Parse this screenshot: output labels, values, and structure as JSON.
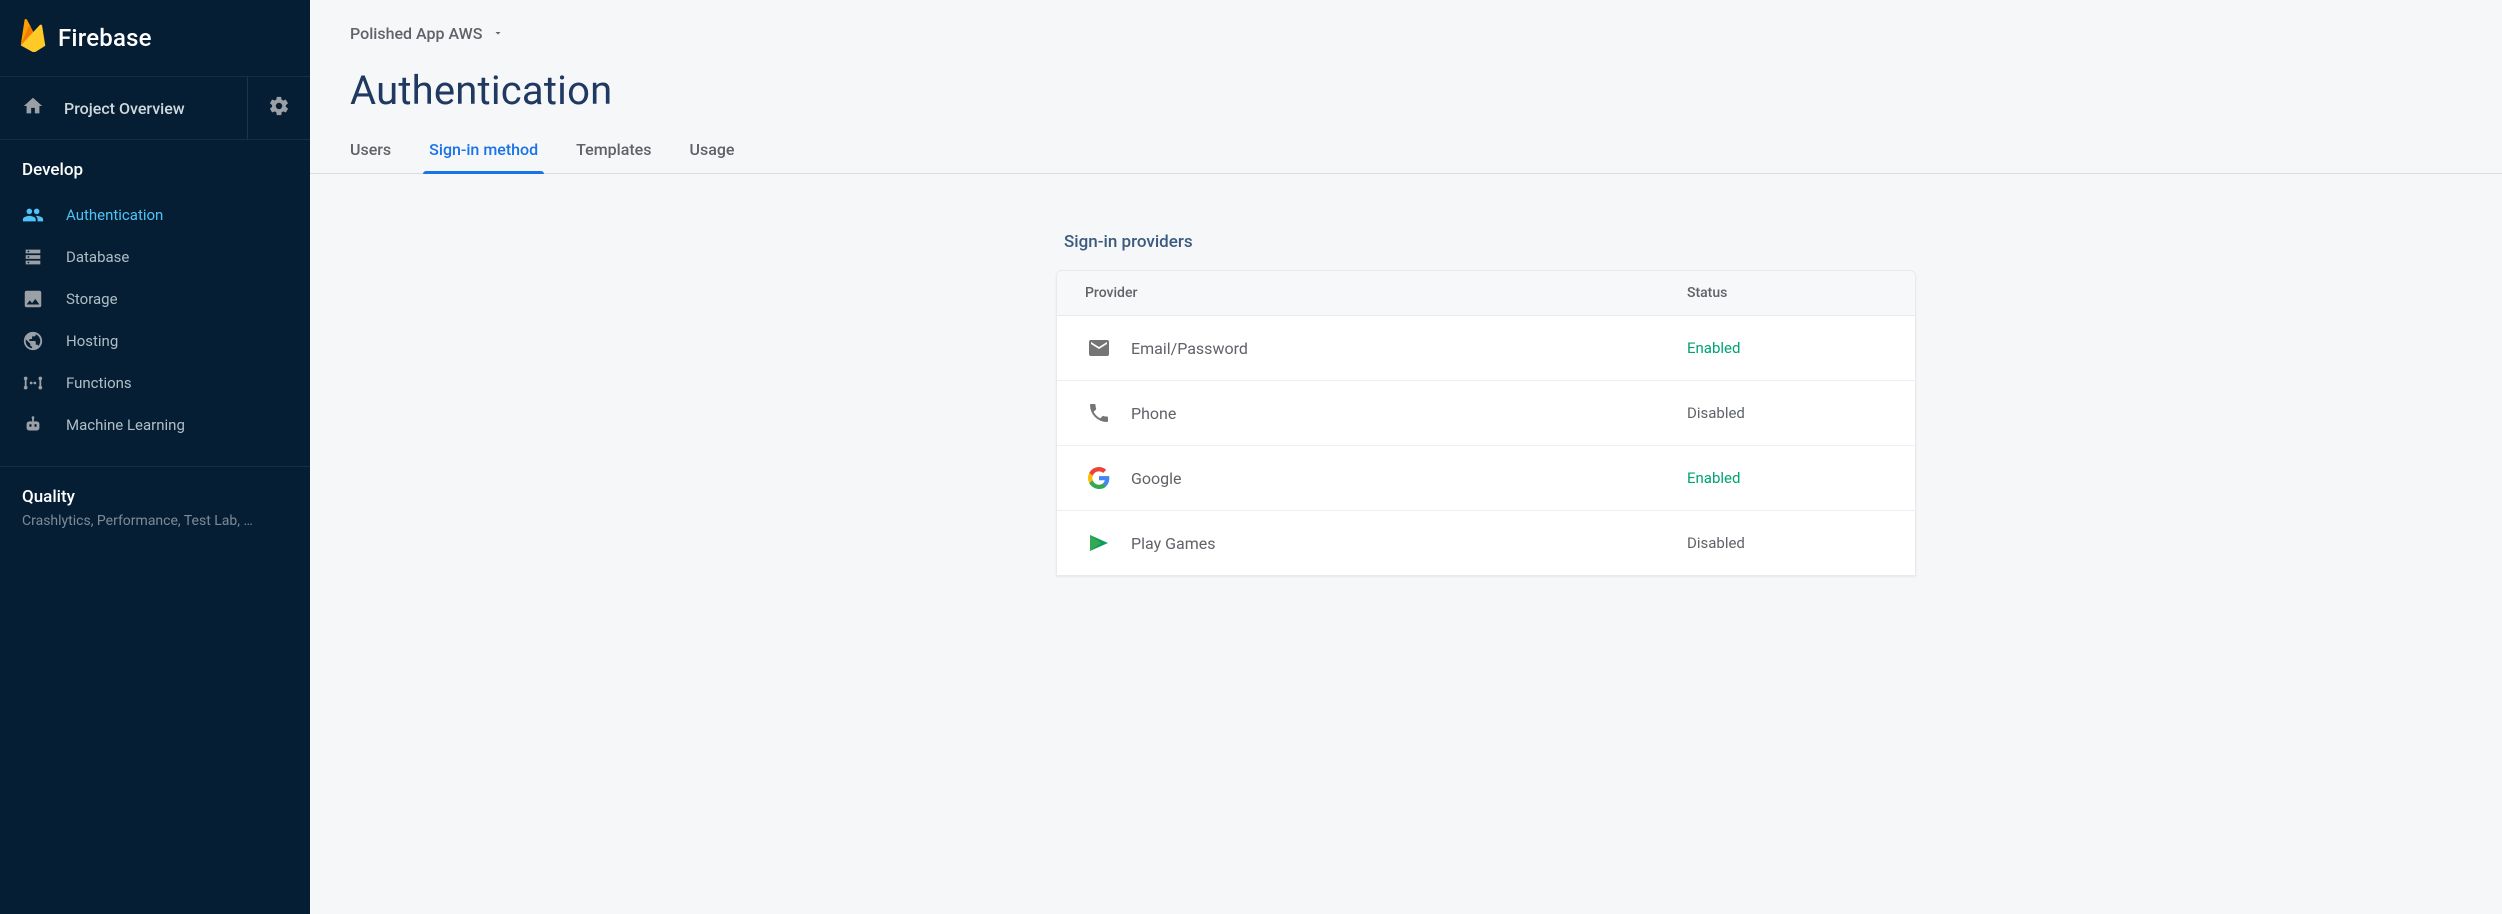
{
  "brand": "Firebase",
  "sidebar": {
    "overview": "Project Overview",
    "sections": {
      "develop": {
        "title": "Develop",
        "items": [
          {
            "label": "Authentication",
            "active": true
          },
          {
            "label": "Database"
          },
          {
            "label": "Storage"
          },
          {
            "label": "Hosting"
          },
          {
            "label": "Functions"
          },
          {
            "label": "Machine Learning"
          }
        ]
      },
      "quality": {
        "title": "Quality",
        "subtitle": "Crashlytics, Performance, Test Lab, …"
      }
    }
  },
  "header": {
    "project_name": "Polished App AWS",
    "page_title": "Authentication",
    "tabs": [
      {
        "label": "Users"
      },
      {
        "label": "Sign-in method",
        "active": true
      },
      {
        "label": "Templates"
      },
      {
        "label": "Usage"
      }
    ]
  },
  "panel": {
    "heading": "Sign-in providers",
    "columns": {
      "provider": "Provider",
      "status": "Status"
    },
    "status_labels": {
      "enabled": "Enabled",
      "disabled": "Disabled"
    },
    "providers": [
      {
        "name": "Email/Password",
        "status": "enabled",
        "icon": "email"
      },
      {
        "name": "Phone",
        "status": "disabled",
        "icon": "phone"
      },
      {
        "name": "Google",
        "status": "enabled",
        "icon": "google"
      },
      {
        "name": "Play Games",
        "status": "disabled",
        "icon": "play-games"
      }
    ]
  }
}
